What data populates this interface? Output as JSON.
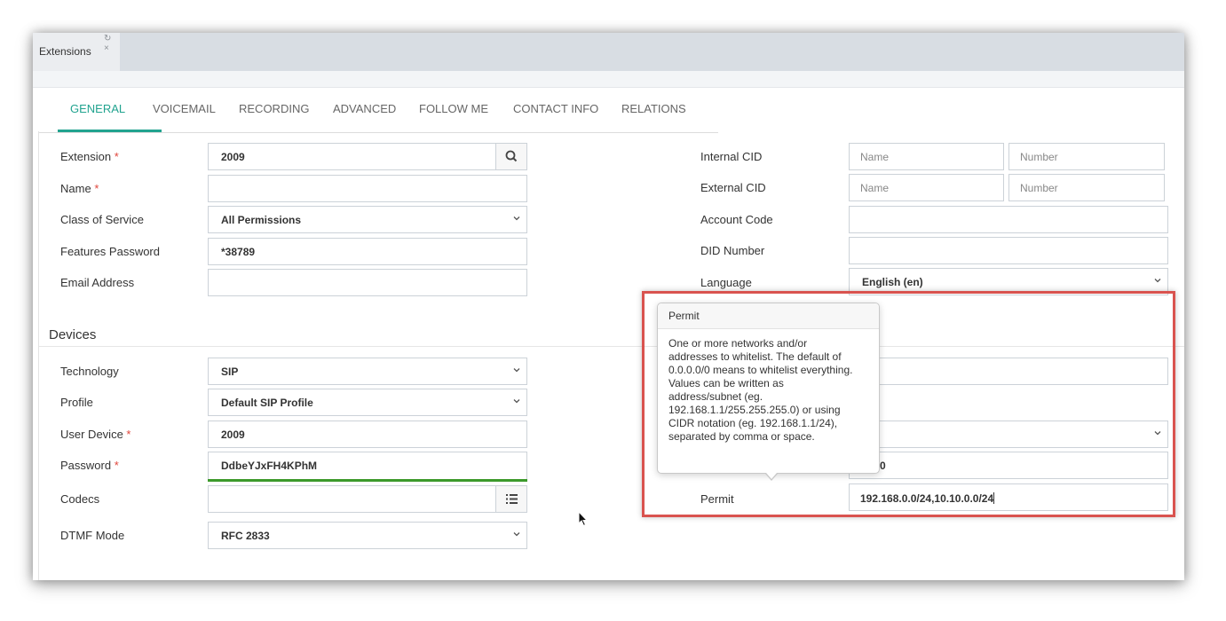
{
  "window_tab": {
    "label": "Extensions",
    "icons": "↻ ×"
  },
  "nav_tabs": [
    "GENERAL",
    "VOICEMAIL",
    "RECORDING",
    "ADVANCED",
    "FOLLOW ME",
    "CONTACT INFO",
    "RELATIONS"
  ],
  "required_mark": "*",
  "left_fields": {
    "extension": {
      "label": "Extension",
      "value": "2009"
    },
    "name": {
      "label": "Name",
      "value": ""
    },
    "class_of_service": {
      "label": "Class of Service",
      "value": "All Permissions"
    },
    "features_password": {
      "label": "Features Password",
      "value": "*38789"
    },
    "email_address": {
      "label": "Email Address",
      "value": ""
    }
  },
  "devices": {
    "title": "Devices",
    "technology": {
      "label": "Technology",
      "value": "SIP"
    },
    "profile": {
      "label": "Profile",
      "value": "Default SIP Profile"
    },
    "user_device": {
      "label": "User Device",
      "value": "2009"
    },
    "password": {
      "label": "Password",
      "value": "DdbeYJxFH4KPhM"
    },
    "codecs": {
      "label": "Codecs",
      "value": ""
    },
    "dtmf_mode": {
      "label": "DTMF Mode",
      "value": "RFC 2833"
    }
  },
  "right_fields": {
    "internal_cid": {
      "label": "Internal CID",
      "name_placeholder": "Name",
      "number_placeholder": "Number"
    },
    "external_cid": {
      "label": "External CID",
      "name_placeholder": "Name",
      "number_placeholder": "Number"
    },
    "account_code": {
      "label": "Account Code",
      "value": ""
    },
    "did_number": {
      "label": "DID Number",
      "value": ""
    },
    "language": {
      "label": "Language",
      "value": "English (en)"
    },
    "deny_value_partial": "0.0/0",
    "permit": {
      "label": "Permit",
      "value": "192.168.0.0/24,10.10.0.0/24"
    }
  },
  "tooltip": {
    "title": "Permit",
    "lines": [
      "One or more networks and/or",
      "addresses to whitelist. The default of",
      "0.0.0.0/0 means to whitelist everything.",
      "Values can be written as",
      "address/subnet (eg.",
      "192.168.1.1/255.255.255.0) or using",
      "CIDR notation (eg. 192.168.1.1/24),",
      "separated by comma or space."
    ]
  },
  "colors": {
    "accent": "#21a38f",
    "highlight_border": "#d9534f",
    "toggle": "#2b6cb0",
    "required": "#e0453b"
  }
}
